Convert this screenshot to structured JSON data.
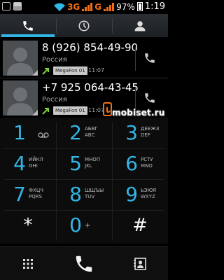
{
  "status_bar": {
    "network_type": "3G",
    "network_type_2": "G",
    "battery": "97%",
    "time": "1:19"
  },
  "tabs": [
    {
      "icon": "phone-icon",
      "active": true
    },
    {
      "icon": "clock-icon",
      "active": false
    },
    {
      "icon": "person-icon",
      "active": false
    }
  ],
  "call_log": [
    {
      "number": "8 (926) 854-49-90",
      "region": "Россия",
      "sim": "MegaFon 01",
      "time": "11:07"
    },
    {
      "number": "+7 925 064-43-45",
      "region": "Россия",
      "sim": "MegaFon 01",
      "time": "11:07"
    }
  ],
  "watermark": "mobiset.ru",
  "dialpad": [
    {
      "digit": "1",
      "letters": "voicemail-icon"
    },
    {
      "digit": "2",
      "letters": "АБВГ\nABC"
    },
    {
      "digit": "3",
      "letters": "ДЕЕЖЗ\nDEF"
    },
    {
      "digit": "4",
      "letters": "ИЙКЛ\nGHI"
    },
    {
      "digit": "5",
      "letters": "МНОП\nJKL"
    },
    {
      "digit": "6",
      "letters": "РСТУ\nMNO"
    },
    {
      "digit": "7",
      "letters": "ФХЦЧ\nPQRS"
    },
    {
      "digit": "8",
      "letters": "ШЩЪЫ\nTUV"
    },
    {
      "digit": "9",
      "letters": "ЬЭЮЯ\nWXYZ"
    },
    {
      "digit": "*",
      "letters": ""
    },
    {
      "digit": "0",
      "letters": "+"
    },
    {
      "digit": "#",
      "letters": ""
    }
  ],
  "colors": {
    "accent": "#33b5e5",
    "status_accent": "#f36f14",
    "missed_call_arrow": "#7fd33a"
  }
}
